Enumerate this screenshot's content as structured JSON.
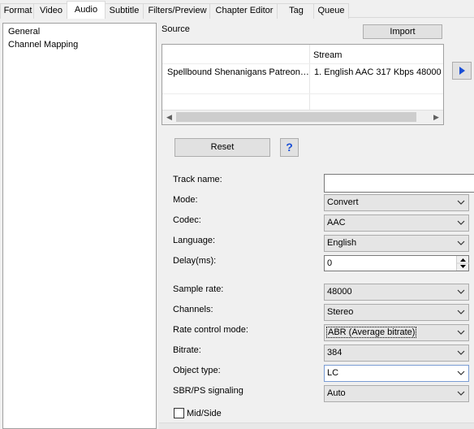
{
  "tabs": [
    "Format",
    "Video",
    "Audio",
    "Subtitle",
    "Filters/Preview",
    "Chapter Editor",
    "Tag",
    "Queue"
  ],
  "active_tab": "Audio",
  "sidebar": {
    "items": [
      "General",
      "Channel Mapping"
    ]
  },
  "source": {
    "label": "Source",
    "import_label": "Import",
    "columns": [
      "",
      "Stream"
    ],
    "rows": [
      {
        "name": "Spellbound Shenanigans Patreon…",
        "stream": "1. English AAC  317 Kbps 48000"
      }
    ]
  },
  "reset_label": "Reset",
  "help_label": "?",
  "fields": {
    "track_name": {
      "label": "Track name:",
      "value": ""
    },
    "mode": {
      "label": "Mode:",
      "value": "Convert"
    },
    "codec": {
      "label": "Codec:",
      "value": "AAC"
    },
    "language": {
      "label": "Language:",
      "value": "English"
    },
    "delay": {
      "label": "Delay(ms):",
      "value": "0"
    },
    "sample_rate": {
      "label": "Sample rate:",
      "value": "48000"
    },
    "channels": {
      "label": "Channels:",
      "value": "Stereo"
    },
    "rate_control": {
      "label": "Rate control mode:",
      "value": "ABR (Average bitrate)"
    },
    "bitrate": {
      "label": "Bitrate:",
      "value": "384"
    },
    "object_type": {
      "label": "Object type:",
      "value": "LC"
    },
    "sbr_ps": {
      "label": "SBR/PS signaling",
      "value": "Auto"
    },
    "mid_side": {
      "label": "Mid/Side",
      "checked": false
    }
  },
  "colors": {
    "accent": "#1a4fd6",
    "window_bg": "#f0f0f0",
    "focus_border": "#7a9cd3"
  },
  "icons": {
    "next": "triangle-right-icon",
    "dropdown": "chevron-down-icon",
    "spin": "spin-up-down-icon"
  }
}
